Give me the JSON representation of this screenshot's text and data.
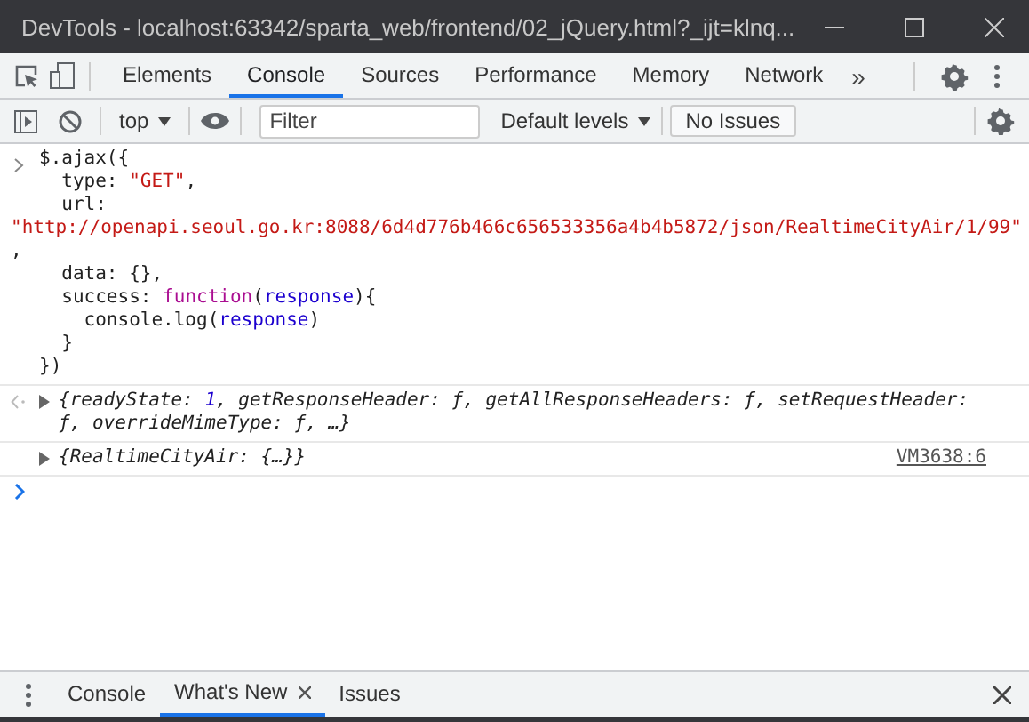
{
  "window": {
    "title": "DevTools - localhost:63342/sparta_web/frontend/02_jQuery.html?_ijt=klnq..."
  },
  "tabs": [
    {
      "label": "Elements",
      "selected": false
    },
    {
      "label": "Console",
      "selected": true
    },
    {
      "label": "Sources",
      "selected": false
    },
    {
      "label": "Performance",
      "selected": false
    },
    {
      "label": "Memory",
      "selected": false
    },
    {
      "label": "Network",
      "selected": false
    }
  ],
  "more_tabs": "»",
  "toolbar": {
    "context": "top",
    "filter": {
      "placeholder": "Filter"
    },
    "levels": "Default levels",
    "issues": "No Issues"
  },
  "console": {
    "entries": [
      {
        "kind": "input",
        "lines": [
          [
            {
              "kind": "plain",
              "text": "$.ajax({"
            }
          ],
          [
            {
              "kind": "plain",
              "text": "  type: "
            },
            {
              "kind": "string",
              "text": "\"GET\""
            },
            {
              "kind": "plain",
              "text": ","
            }
          ],
          [
            {
              "kind": "plain",
              "text": "  url:"
            }
          ],
          [
            {
              "kind": "string",
              "text": "\"http://openapi.seoul.go.kr:8088/6d4d776b466c656533356a4b4b5872/json/RealtimeCityAir/1/99\""
            }
          ],
          [
            {
              "kind": "plain",
              "text": ","
            }
          ],
          [
            {
              "kind": "plain",
              "text": "  data: {},"
            }
          ],
          [
            {
              "kind": "plain",
              "text": "  success: "
            },
            {
              "kind": "keyword",
              "text": "function"
            },
            {
              "kind": "plain",
              "text": "("
            },
            {
              "kind": "param",
              "text": "response"
            },
            {
              "kind": "plain",
              "text": "){"
            }
          ],
          [
            {
              "kind": "plain",
              "text": "    console.log("
            },
            {
              "kind": "param",
              "text": "response"
            },
            {
              "kind": "plain",
              "text": ")"
            }
          ],
          [
            {
              "kind": "plain",
              "text": "  }"
            }
          ],
          [
            {
              "kind": "plain",
              "text": "})"
            }
          ]
        ]
      },
      {
        "kind": "result",
        "expanded": false,
        "segments": [
          {
            "kind": "plain",
            "text": "{readyState: "
          },
          {
            "kind": "number",
            "text": "1"
          },
          {
            "kind": "plain",
            "text": ", getResponseHeader: ƒ, getAllResponseHeaders: ƒ, setRequestHeader: ƒ, overrideMimeType: ƒ, …}"
          }
        ]
      },
      {
        "kind": "log",
        "expanded": false,
        "segments": [
          {
            "kind": "plain",
            "text": "{RealtimeCityAir: {…}}"
          }
        ],
        "source": "VM3638:6"
      }
    ]
  },
  "drawer": {
    "tabs": [
      {
        "label": "Console",
        "selected": false,
        "closable": false
      },
      {
        "label": "What's New",
        "selected": true,
        "closable": true
      },
      {
        "label": "Issues",
        "selected": false,
        "closable": false
      }
    ]
  }
}
